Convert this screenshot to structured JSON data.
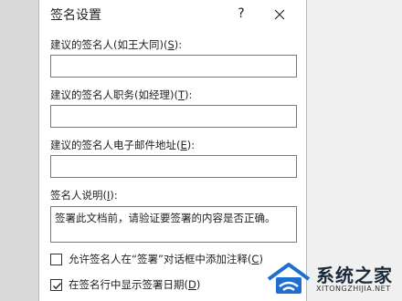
{
  "dialog": {
    "title": "签名设置",
    "help_label": "?"
  },
  "fields": {
    "signer_name": {
      "label": "建议的签名人(如王大同)(",
      "accel": "S",
      "tail": "):",
      "value": ""
    },
    "signer_title": {
      "label": "建议的签名人职务(如经理)(",
      "accel": "T",
      "tail": "):",
      "value": ""
    },
    "signer_email": {
      "label": "建议的签名人电子邮件地址(",
      "accel": "E",
      "tail": "):",
      "value": ""
    }
  },
  "instructions": {
    "label": "签名人说明(",
    "accel": "I",
    "tail": "):",
    "value": "签署此文档前，请验证要签署的内容是否正确。"
  },
  "options": {
    "allow_comments": {
      "label": "允许签名人在“签署”对话框中添加注释(",
      "accel": "C",
      "tail": ")",
      "checked": false
    },
    "show_date": {
      "label": "在签名行中显示签署日期(",
      "accel": "D",
      "tail": ")",
      "checked": true
    }
  },
  "watermark": {
    "name": "系统之家",
    "url": "XITONGZHIJIA.NET"
  },
  "colors": {
    "dialog_bg": "#ffffff",
    "backdrop": "#dcdcdc",
    "field_border": "#7a7a7a",
    "logo_blue": "#1f6fd1"
  }
}
